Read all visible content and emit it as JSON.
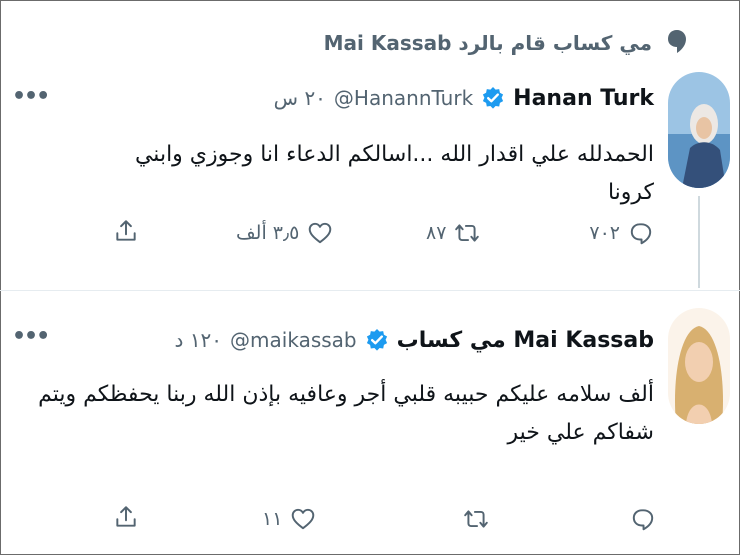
{
  "context": {
    "text": "Mai Kassab مي كساب قام بالرد"
  },
  "tweets": [
    {
      "name": "Hanan Turk",
      "handle": "@HanannTurk",
      "time": "٢٠ س",
      "text": "الحمدلله علي اقدار الله ...اسالكم الدعاء انا وجوزي وابني كرونا",
      "reply_count": "٧٠٢",
      "retweet_count": "٨٧",
      "like_count": "٣٫٥ ألف",
      "avatar_colors": {
        "sky": "#9cc4e4",
        "sea": "#5d94c4",
        "scarf": "#ece8e4",
        "face": "#e8c4a4",
        "coat": "#34507a"
      }
    },
    {
      "name": "مي كساب Mai Kassab",
      "handle": "@maikassab",
      "time": "١٢٠ د",
      "text": "ألف سلامه عليكم حبيبه قلبي أجر وعافيه بإذن الله ربنا يحفظكم ويتم شفاكم علي خير",
      "reply_count": "",
      "retweet_count": "",
      "like_count": "١١",
      "avatar_colors": {
        "bg": "#fbf3ea",
        "hair": "#d8b070",
        "face": "#f2cfb0"
      }
    }
  ],
  "colors": {
    "verified": "#1d9bf0",
    "text": "#0f1419",
    "muted": "#536471"
  },
  "icons": {
    "more": "more-icon",
    "reply": "reply-icon",
    "retweet": "retweet-icon",
    "like": "heart-icon",
    "share": "share-icon",
    "verified": "verified-badge-icon",
    "context": "speech-bubble-icon"
  }
}
